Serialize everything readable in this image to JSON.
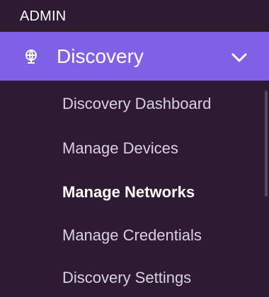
{
  "section": {
    "title": "ADMIN"
  },
  "nav_group": {
    "label": "Discovery",
    "icon": "globe-icon",
    "expanded_icon": "chevron-down-icon",
    "colors": {
      "background": "#2f1a33",
      "header": "#7f61e8"
    }
  },
  "submenu": {
    "items": [
      {
        "label": "Discovery Dashboard",
        "active": false
      },
      {
        "label": "Manage Devices",
        "active": false
      },
      {
        "label": "Manage Networks",
        "active": true
      },
      {
        "label": "Manage Credentials",
        "active": false
      },
      {
        "label": "Discovery Settings",
        "active": false
      }
    ]
  }
}
